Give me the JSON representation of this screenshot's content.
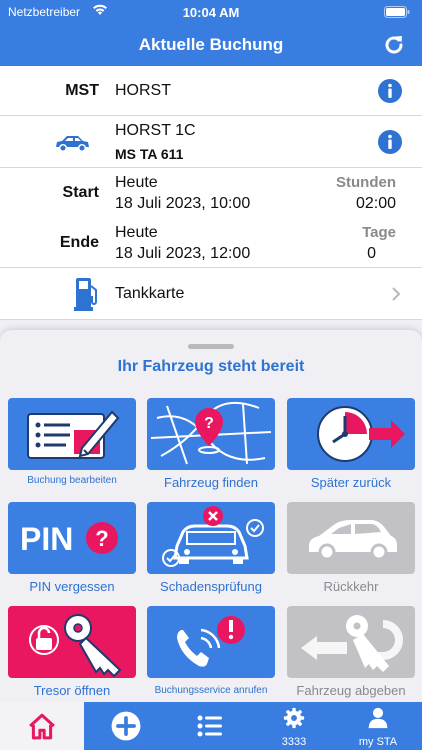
{
  "status_bar": {
    "carrier": "Netzbetreiber",
    "time": "10:04 AM"
  },
  "navbar": {
    "title": "Aktuelle Buchung"
  },
  "booking": {
    "mst_label": "MST",
    "mst_value": "HORST",
    "vehicle_name": "HORST 1C",
    "vehicle_plate": "MS TA 611",
    "start_label": "Start",
    "start_day": "Heute",
    "start_datetime": "18 Juli 2023, 10:00",
    "hours_label": "Stunden",
    "hours_value": "02:00",
    "end_label": "Ende",
    "end_day": "Heute",
    "end_datetime": "18 Juli 2023, 12:00",
    "days_label": "Tage",
    "days_value": "0",
    "fuel_card_label": "Tankkarte"
  },
  "sheet": {
    "title": "Ihr Fahrzeug steht bereit",
    "actions": [
      {
        "label": "Buchung bearbeiten",
        "icon": "edit-booking-icon",
        "state": "enabled"
      },
      {
        "label": "Fahrzeug finden",
        "icon": "map-pin-icon",
        "state": "enabled"
      },
      {
        "label": "Später zurück",
        "icon": "clock-arrow-icon",
        "state": "enabled"
      },
      {
        "label": "PIN vergessen",
        "icon": "pin-question-icon",
        "state": "enabled"
      },
      {
        "label": "Schadensprüfung",
        "icon": "damage-check-icon",
        "state": "enabled"
      },
      {
        "label": "Rückkehr",
        "icon": "car-return-icon",
        "state": "disabled"
      },
      {
        "label": "Tresor öffnen",
        "icon": "lock-key-icon",
        "state": "highlighted"
      },
      {
        "label": "Buchungsservice anrufen",
        "icon": "phone-alert-icon",
        "state": "enabled"
      },
      {
        "label": "Fahrzeug abgeben",
        "icon": "key-return-icon",
        "state": "disabled"
      }
    ],
    "pin_text": "PIN"
  },
  "tabbar": {
    "tabs": [
      {
        "icon": "home-icon",
        "label": ""
      },
      {
        "icon": "plus-icon",
        "label": ""
      },
      {
        "icon": "list-icon",
        "label": ""
      },
      {
        "icon": "gear-icon",
        "label": "3333"
      },
      {
        "icon": "user-icon",
        "label": "my STA"
      }
    ]
  },
  "colors": {
    "primary": "#3a7de0",
    "accent_pink": "#e8175f",
    "disabled_grey": "#c2c2c6"
  }
}
